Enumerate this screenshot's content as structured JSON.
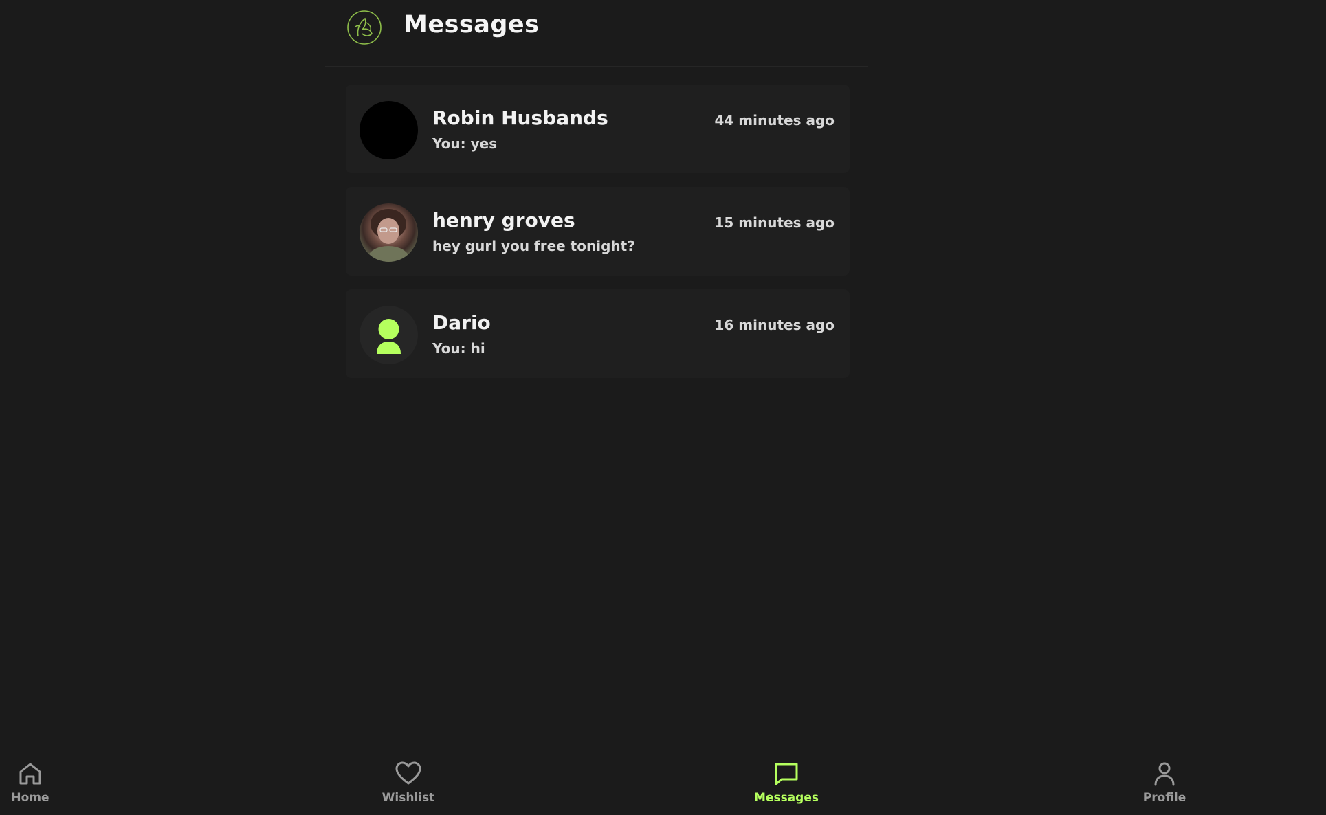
{
  "header": {
    "title": "Messages",
    "logo_icon": "leaf-hand-logo-icon"
  },
  "colors": {
    "background": "#1b1b1b",
    "accent": "#b5ff5e",
    "muted": "#9a9a9a"
  },
  "conversations": [
    {
      "name": "Robin Husbands",
      "preview": "You: yes",
      "time": "44 minutes ago",
      "avatar": "black-avatar"
    },
    {
      "name": "henry groves",
      "preview": "hey gurl you free tonight?",
      "time": "15 minutes ago",
      "avatar": "photo-avatar"
    },
    {
      "name": "Dario",
      "preview": "You: hi",
      "time": "16 minutes ago",
      "avatar": "default-person-avatar"
    }
  ],
  "nav": {
    "items": [
      {
        "label": "Home",
        "icon": "home-icon",
        "active": false
      },
      {
        "label": "Wishlist",
        "icon": "heart-icon",
        "active": false
      },
      {
        "label": "Messages",
        "icon": "chat-bubble-icon",
        "active": true
      },
      {
        "label": "Profile",
        "icon": "person-icon",
        "active": false
      }
    ]
  }
}
